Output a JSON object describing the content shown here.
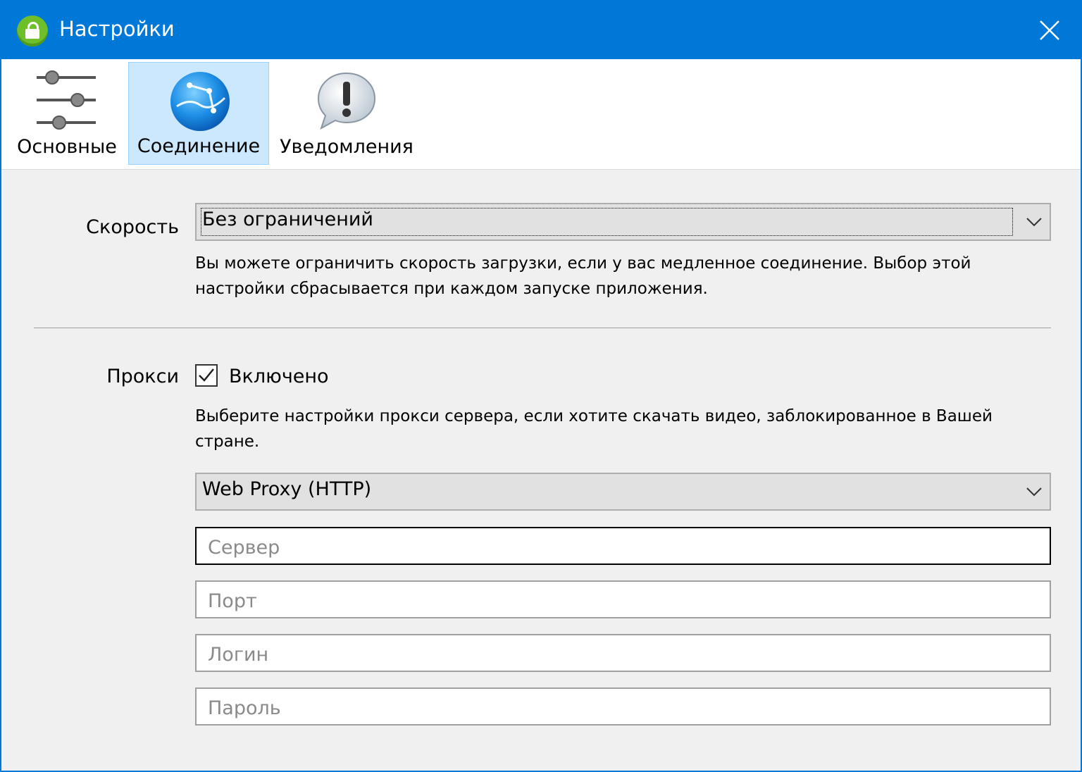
{
  "window": {
    "title": "Настройки",
    "accent_color": "#0078d7",
    "app_icon": "lock-globe-icon",
    "close_icon": "close-icon"
  },
  "tabs": [
    {
      "label": "Основные",
      "icon": "sliders-icon",
      "active": false
    },
    {
      "label": "Соединение",
      "icon": "globe-icon",
      "active": true
    },
    {
      "label": "Уведомления",
      "icon": "exclamation-bubble-icon",
      "active": false
    }
  ],
  "speed": {
    "label": "Скорость",
    "selected": "Без ограничений",
    "description": "Вы можете ограничить скорость загрузки, если у вас медленное соединение. Выбор этой настройки сбрасывается при каждом запуске приложения."
  },
  "proxy": {
    "label": "Прокси",
    "enabled_label": "Включено",
    "enabled": true,
    "description": "Выберите настройки прокси сервера, если хотите скачать видео, заблокированное в Вашей стране.",
    "type_selected": "Web Proxy (HTTP)",
    "server_placeholder": "Сервер",
    "port_placeholder": "Порт",
    "login_placeholder": "Логин",
    "password_placeholder": "Пароль"
  }
}
